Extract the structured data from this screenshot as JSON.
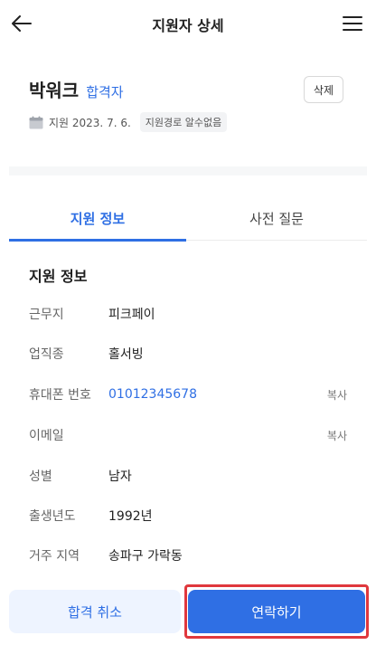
{
  "header": {
    "title": "지원자 상세"
  },
  "profile": {
    "name": "박워크",
    "status": "합격자",
    "delete_label": "삭제",
    "applied_date": "지원 2023. 7. 6.",
    "source": "지원경로 알수없음"
  },
  "tabs": [
    {
      "label": "지원 정보",
      "active": true
    },
    {
      "label": "사전 질문",
      "active": false
    }
  ],
  "section_title": "지원 정보",
  "info_rows": [
    {
      "label": "근무지",
      "value": "피크페이"
    },
    {
      "label": "업직종",
      "value": "홀서빙"
    },
    {
      "label": "휴대폰 번호",
      "value": "01012345678",
      "copy": "복사"
    },
    {
      "label": "이메일",
      "value": "",
      "copy": "복사"
    },
    {
      "label": "성별",
      "value": "남자"
    },
    {
      "label": "출생년도",
      "value": "1992년"
    },
    {
      "label": "거주 지역",
      "value": "송파구 가락동"
    }
  ],
  "footer": {
    "cancel_label": "합격 취소",
    "contact_label": "연락하기"
  },
  "colors": {
    "accent": "#2f6fe4",
    "highlight": "#e0383d",
    "cancel_bg": "#eef4ff"
  }
}
